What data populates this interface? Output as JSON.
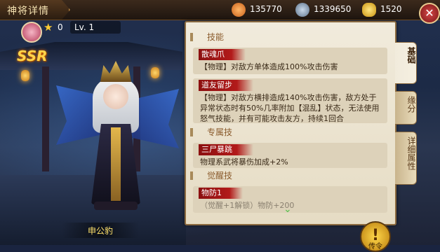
{
  "header": {
    "title": "神将详情",
    "resources": [
      {
        "icon": "meat-bun-icon",
        "value": "135770"
      },
      {
        "icon": "coin-icon",
        "value": "1339650"
      },
      {
        "icon": "gold-ingot-icon",
        "value": "1520"
      }
    ],
    "close_icon": "close-icon"
  },
  "hero": {
    "star_count": "0",
    "level": "Lv. 1",
    "rarity": "SSR",
    "name": "申公豹"
  },
  "panel": {
    "sections": [
      {
        "title": "技能"
      },
      {
        "title": "专属技"
      },
      {
        "title": "觉醒技"
      }
    ],
    "skills": [
      {
        "name": "散魂爪",
        "desc": "【物理】对敌方单体造成100%攻击伤害"
      },
      {
        "name": "道友留步",
        "desc": "【物理】对敌方横排造成140%攻击伤害，敌方处于异常状态时有50%几率附加【混乱】状态，无法使用怒气技能，并有可能攻击友方，持续1回合"
      },
      {
        "name": "三尸暴跳",
        "desc": "物理系武将暴伤加成+2%"
      },
      {
        "name": "物防1",
        "desc": "（觉醒+1解锁）物防+200"
      }
    ],
    "tabs": [
      "基础",
      "缘分",
      "详细属性"
    ],
    "active_tab": "基础"
  },
  "strategy_button": {
    "label": "传令"
  },
  "colors": {
    "accent_gold": "#ffd54a",
    "skill_red": "#b21a1a",
    "panel_bg": "#f1ebdc"
  }
}
